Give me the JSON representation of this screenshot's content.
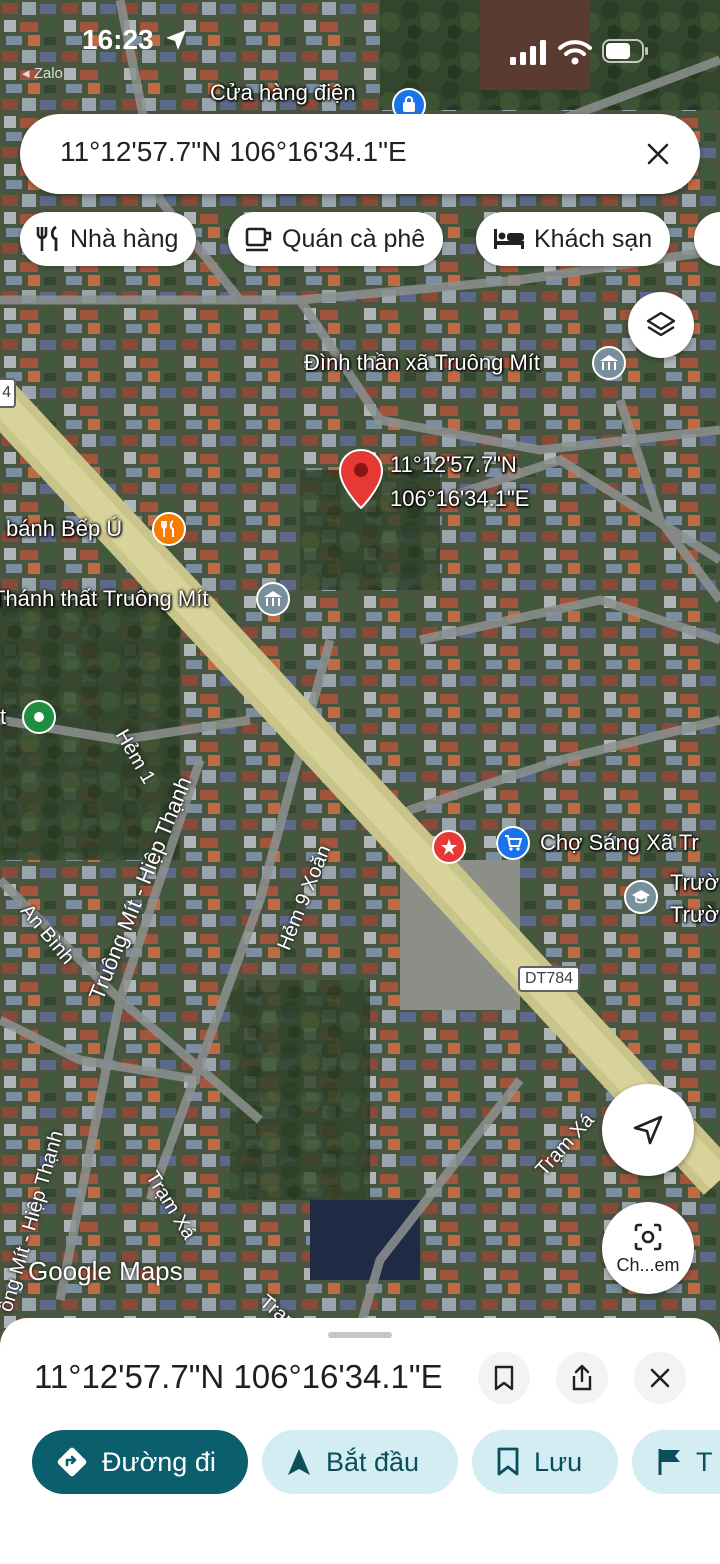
{
  "status_bar": {
    "time": "16:23",
    "back_app": "Zalo"
  },
  "search": {
    "query": "11°12'57.7\"N 106°16'34.1\"E"
  },
  "chips": [
    {
      "label": "Nhà hàng",
      "icon": "fork-knife-icon"
    },
    {
      "label": "Quán cà phê",
      "icon": "coffee-cup-icon"
    },
    {
      "label": "Khách sạn",
      "icon": "bed-icon"
    }
  ],
  "map": {
    "pin": {
      "line1": "11°12'57.7\"N",
      "line2": "106°16'34.1\"E"
    },
    "places": {
      "cua_hang_dien": "Cửa hàng điện",
      "dinh_than": "Đình thần xã Truông Mít",
      "bep_u": "bánh Bếp Ú",
      "thanh_that": "Thánh thất Truông Mít",
      "cho_sang": "Chợ Sáng Xã Tr",
      "truong_1": "Trườ",
      "truong_2": "Trườ"
    },
    "roads": {
      "hem1": "Hẻm 1",
      "truong_mit_hiep_thanh": "Truông Mít - Hiệp Thạnh",
      "hem9xoan": "Hẻm 9 Xoăn",
      "an_binh": "An Bình",
      "dt784": "DT784",
      "tram_xa_1": "Trạm Xá",
      "tram_xa_2": "Trạm Xá",
      "truong_mit_2": "ông Mít - Hiệp Thạnh",
      "tram_3": "Trạm",
      "edge_marker": "4",
      "edge_t": "t"
    },
    "watermark": "Google Maps",
    "lens_label": "Ch...em"
  },
  "sheet": {
    "title": "11°12'57.7\"N 106°16'34.1\"E",
    "actions": [
      {
        "label": "Đường đi",
        "icon": "directions-icon"
      },
      {
        "label": "Bắt đầu",
        "icon": "navigation-arrow-icon"
      },
      {
        "label": "Lưu",
        "icon": "bookmark-icon"
      },
      {
        "label": "T",
        "icon": "flag-icon"
      }
    ]
  },
  "colors": {
    "primary": "#0b5e6b",
    "secondary_bg": "#d3edf2",
    "pin": "#e53935",
    "poi_blue": "#1a73e8",
    "poi_orange": "#f57c00",
    "poi_gray": "#78909c",
    "poi_green": "#1e8e3e"
  }
}
